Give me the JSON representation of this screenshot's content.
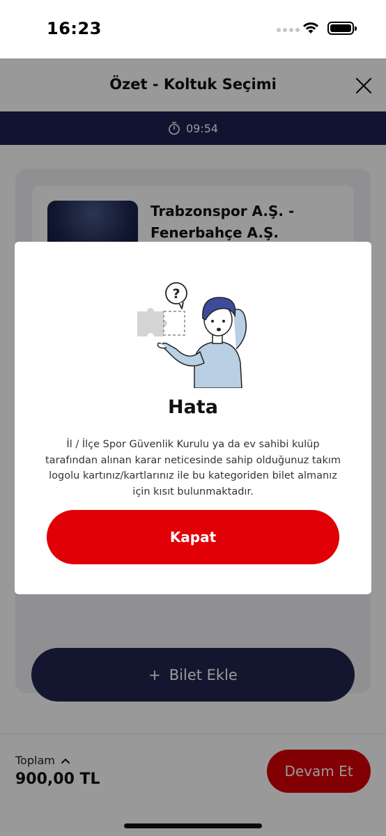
{
  "status_bar": {
    "time": "16:23"
  },
  "header": {
    "title": "Özet - Koltuk Seçimi"
  },
  "timer": {
    "value": "09:54"
  },
  "event": {
    "title_line1": "Trabzonspor A.Ş. -",
    "title_line2": "Fenerbahçe A.Ş."
  },
  "add_ticket": {
    "plus": "+",
    "label": "Bilet Ekle"
  },
  "footer": {
    "total_label": "Toplam",
    "total_amount": "900,00 TL",
    "continue_label": "Devam Et"
  },
  "modal": {
    "title": "Hata",
    "message": "İl / İlçe Spor Güvenlik Kurulu ya da ev sahibi kulüp tarafından alınan karar neticesinde sahip olduğunuz takım logolu kartınız/kartlarınız ile bu kategoriden bilet almanız için kısıt bulunmaktadır.",
    "button_label": "Kapat",
    "illustration_glyph": "?"
  },
  "colors": {
    "navy": "#1f2152",
    "accent_red": "#e00006",
    "card_bg": "#f1f1f6"
  }
}
